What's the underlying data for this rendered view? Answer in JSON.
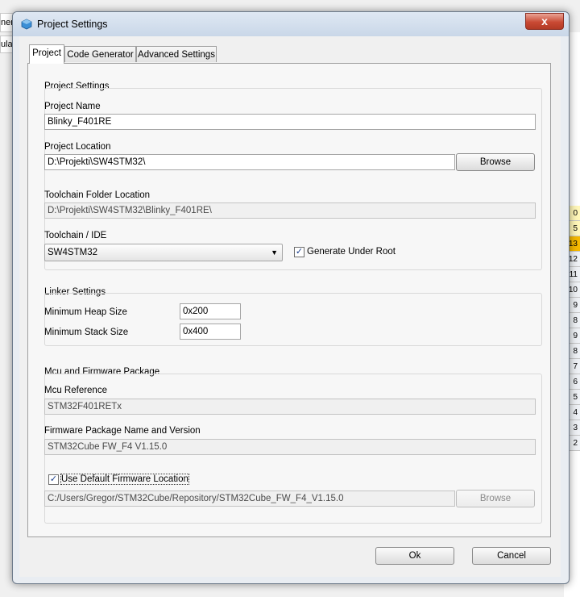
{
  "background": {
    "left_top_fragment": "ner",
    "left_mid_fragment": "ulat",
    "right_cells": [
      "0",
      "5",
      "13",
      "12",
      "11",
      "10",
      "9",
      "8",
      "9",
      "8",
      "7",
      "6",
      "5",
      "4",
      "3",
      "2"
    ],
    "highlight_cell_color": "#f5b800"
  },
  "window": {
    "title": "Project Settings",
    "close_label": "x"
  },
  "tabs": [
    {
      "label": "Project"
    },
    {
      "label": "Code Generator"
    },
    {
      "label": "Advanced Settings"
    }
  ],
  "project_settings": {
    "group_title": "Project Settings",
    "project_name_label": "Project Name",
    "project_name_value": "Blinky_F401RE",
    "project_location_label": "Project Location",
    "project_location_value": "D:\\Projekti\\SW4STM32\\",
    "browse_label": "Browse",
    "toolchain_folder_label": "Toolchain Folder Location",
    "toolchain_folder_value": "D:\\Projekti\\SW4STM32\\Blinky_F401RE\\",
    "toolchain_ide_label": "Toolchain / IDE",
    "toolchain_ide_value": "SW4STM32",
    "generate_under_root_label": "Generate Under Root",
    "generate_under_root_checked": true
  },
  "linker_settings": {
    "group_title": "Linker Settings",
    "min_heap_label": "Minimum Heap Size",
    "min_heap_value": "0x200",
    "min_stack_label": "Minimum Stack Size",
    "min_stack_value": "0x400"
  },
  "mcu_firmware": {
    "group_title": "Mcu and Firmware Package",
    "mcu_reference_label": "Mcu Reference",
    "mcu_reference_value": "STM32F401RETx",
    "firmware_package_label": "Firmware Package Name and Version",
    "firmware_package_value": "STM32Cube FW_F4 V1.15.0",
    "use_default_label": "Use Default Firmware Location",
    "use_default_checked": true,
    "firmware_location_value": "C:/Users/Gregor/STM32Cube/Repository/STM32Cube_FW_F4_V1.15.0",
    "browse_label": "Browse"
  },
  "footer": {
    "ok_label": "Ok",
    "cancel_label": "Cancel"
  }
}
